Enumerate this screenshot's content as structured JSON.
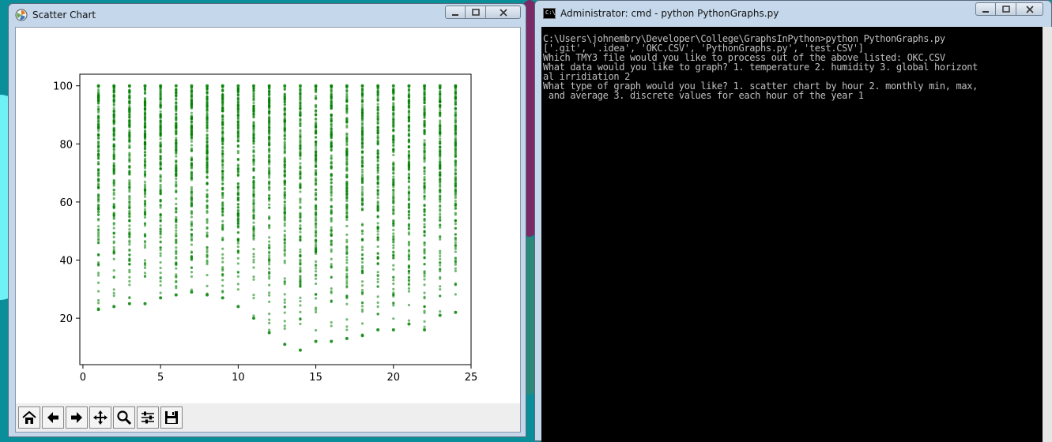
{
  "scatter_window": {
    "title": "Scatter Chart",
    "caption_buttons": [
      "minimize",
      "maximize",
      "close"
    ],
    "toolbar": [
      {
        "name": "home",
        "icon": "home-icon"
      },
      {
        "name": "back",
        "icon": "back-arrow-icon"
      },
      {
        "name": "forward",
        "icon": "forward-arrow-icon"
      },
      {
        "name": "pan",
        "icon": "pan-icon"
      },
      {
        "name": "zoom",
        "icon": "zoom-icon"
      },
      {
        "name": "configure-subplots",
        "icon": "sliders-icon"
      },
      {
        "name": "save",
        "icon": "save-icon"
      }
    ]
  },
  "cmd_window": {
    "title": "Administrator: cmd - python  PythonGraphs.py",
    "console_lines": [
      "C:\\Users\\johnembry\\Developer\\College\\GraphsInPython>python PythonGraphs.py",
      "['.git', '.idea', 'OKC.CSV', 'PythonGraphs.py', 'test.CSV']",
      "Which TMY3 file would you like to process out of the above listed: OKC.CSV",
      "What data would you like to graph? 1. temperature 2. humidity 3. global horizont",
      "al irridiation 2",
      "What type of graph would you like? 1. scatter chart by hour 2. monthly min, max,",
      " and average 3. discrete values for each hour of the year 1"
    ]
  },
  "chart_data": {
    "type": "scatter",
    "title": "",
    "xlabel": "",
    "ylabel": "",
    "xlim": [
      -0.2,
      25
    ],
    "ylim": [
      4,
      104
    ],
    "xticks": [
      0,
      5,
      10,
      15,
      20,
      25
    ],
    "yticks": [
      20,
      40,
      60,
      80,
      100
    ],
    "grid": false,
    "color": "#008000",
    "hours": [
      1,
      2,
      3,
      4,
      5,
      6,
      7,
      8,
      9,
      10,
      11,
      12,
      13,
      14,
      15,
      16,
      17,
      18,
      19,
      20,
      21,
      22,
      23,
      24
    ],
    "hourly_min": [
      23,
      24,
      25,
      25,
      27,
      28,
      29,
      28,
      27,
      24,
      20,
      15,
      11,
      9,
      12,
      12,
      13,
      14,
      16,
      16,
      18,
      16,
      21,
      22
    ],
    "hourly_max": [
      100,
      100,
      100,
      100,
      100,
      100,
      100,
      100,
      100,
      100,
      100,
      100,
      100,
      100,
      100,
      100,
      100,
      100,
      100,
      100,
      100,
      100,
      100,
      100
    ]
  }
}
